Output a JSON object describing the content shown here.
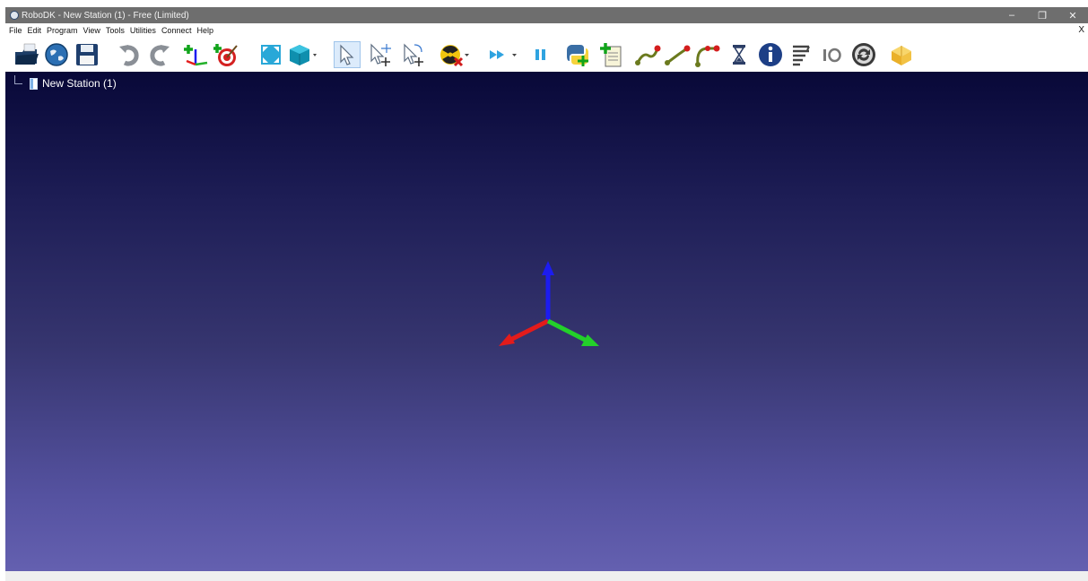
{
  "window": {
    "title": "RoboDK - New Station (1) - Free (Limited)",
    "minimize_glyph": "–",
    "restore_glyph": "❐",
    "close_glyph": "✕"
  },
  "menu": {
    "items": [
      "File",
      "Edit",
      "Program",
      "View",
      "Tools",
      "Utilities",
      "Connect",
      "Help"
    ],
    "close_glyph": "X"
  },
  "toolbar": {
    "buttons": [
      "open-icon",
      "online-library-icon",
      "save-icon",
      "undo-icon",
      "redo-icon",
      "add-reference-frame-icon",
      "add-target-icon",
      "fit-all-icon",
      "isometric-view-icon",
      "select-icon",
      "select-plus-icon",
      "select-move-icon",
      "collision-icon",
      "fast-simulation-icon",
      "pause-icon",
      "python-program-icon",
      "add-program-icon",
      "move-joint-icon",
      "move-linear-icon",
      "move-circular-icon",
      "pause-instruction-icon",
      "info-icon",
      "set-io-icon",
      "io-icon",
      "program-call-icon",
      "add-station-icon"
    ],
    "colors": {
      "select_bg": "#dcebfb",
      "python_blue": "#3a6ea5",
      "python_yellow": "#f6d33c"
    }
  },
  "tree": {
    "station_label": "New Station (1)"
  },
  "viewport": {
    "axis_colors": {
      "x": "#e31b1b",
      "y": "#23d12a",
      "z": "#1c1cf0"
    },
    "background_top": "#080838",
    "background_bottom": "#6460b0"
  }
}
